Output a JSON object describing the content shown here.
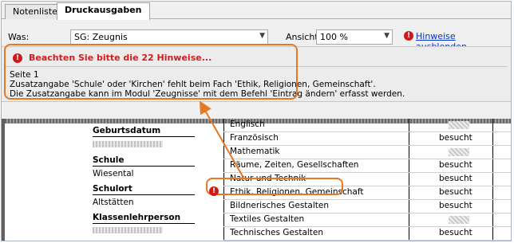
{
  "tabs": [
    {
      "label": "Notenliste",
      "active": false
    },
    {
      "label": "Druckausgaben",
      "active": true
    }
  ],
  "toolbar": {
    "was_label": "Was:",
    "was_value": "SG: Zeugnis",
    "ansicht_label": "Ansicht:",
    "ansicht_value": "100 %",
    "hide_hints_link": "Hinweise ausblenden..."
  },
  "notice": {
    "title": "Beachten Sie bitte die 22 Hinweise...",
    "page": "Seite 1",
    "line1": "Zusatzangabe 'Schule' oder 'Kirchen' fehlt beim Fach 'Ethik, Religionen, Gemeinschaft'.",
    "line2": "Die Zusatzangabe kann im Modul 'Zeugnisse' mit dem Befehl 'Eintrag ändern' erfasst werden."
  },
  "document": {
    "left_fields": [
      {
        "label": "Geburtsdatum",
        "value": ""
      },
      {
        "label": "Schule",
        "value": "Wiesental"
      },
      {
        "label": "Schulort",
        "value": "Altstätten"
      },
      {
        "label": "Klassenlehrperson",
        "value": ""
      }
    ],
    "subjects": [
      {
        "name": "Englisch",
        "status": ""
      },
      {
        "name": "Französisch",
        "status": "besucht"
      },
      {
        "name": "Mathematik",
        "status": ""
      },
      {
        "name": "Räume, Zeiten, Gesellschaften",
        "status": "besucht"
      },
      {
        "name": "Natur und Technik",
        "status": "besucht"
      },
      {
        "name": "Ethik, Religionen, Gemeinschaft",
        "status": "besucht"
      },
      {
        "name": "Bildnerisches Gestalten",
        "status": "besucht"
      },
      {
        "name": "Textiles Gestalten",
        "status": ""
      },
      {
        "name": "Technisches Gestalten",
        "status": "besucht"
      }
    ]
  },
  "colors": {
    "error": "#cc1b1b",
    "link": "#0033cc",
    "callout": "#e87722"
  },
  "icons": {
    "error_icon": "exclamation-circle-icon",
    "dropdown_icon": "chevron-down-icon",
    "arrow_icon": "arrow-icon"
  }
}
